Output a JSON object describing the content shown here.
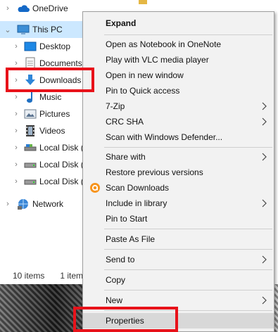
{
  "nav": {
    "items": [
      {
        "label": "OneDrive",
        "icon": "cloud-icon"
      },
      {
        "label": "This PC",
        "icon": "computer-icon"
      },
      {
        "label": "Desktop",
        "icon": "desktop-icon"
      },
      {
        "label": "Documents",
        "icon": "documents-icon"
      },
      {
        "label": "Downloads",
        "icon": "downloads-icon"
      },
      {
        "label": "Music",
        "icon": "music-icon"
      },
      {
        "label": "Pictures",
        "icon": "pictures-icon"
      },
      {
        "label": "Videos",
        "icon": "videos-icon"
      },
      {
        "label": "Local Disk (",
        "icon": "disk-icon"
      },
      {
        "label": "Local Disk (",
        "icon": "disk-icon"
      },
      {
        "label": "Local Disk (",
        "icon": "disk-icon"
      },
      {
        "label": "Network",
        "icon": "network-icon"
      }
    ]
  },
  "status": {
    "items_count": "10 items",
    "selected": "1 item"
  },
  "context_menu": {
    "items": [
      {
        "label": "Expand",
        "bold": true
      },
      {
        "label": "Open as Notebook in OneNote"
      },
      {
        "label": "Play with VLC media player"
      },
      {
        "label": "Open in new window"
      },
      {
        "label": "Pin to Quick access"
      },
      {
        "label": "7-Zip",
        "submenu": true
      },
      {
        "label": "CRC SHA",
        "submenu": true
      },
      {
        "label": "Scan with Windows Defender..."
      },
      {
        "label": "Share with",
        "submenu": true
      },
      {
        "label": "Restore previous versions"
      },
      {
        "label": "Scan Downloads",
        "icon": "avast-icon"
      },
      {
        "label": "Include in library",
        "submenu": true
      },
      {
        "label": "Pin to Start"
      },
      {
        "label": "Paste As File"
      },
      {
        "label": "Send to",
        "submenu": true
      },
      {
        "label": "Copy"
      },
      {
        "label": "New",
        "submenu": true
      },
      {
        "label": "Properties"
      }
    ]
  },
  "colors": {
    "annotation_red": "#e8121a",
    "selection_blue": "#cce8ff",
    "menu_bg": "#f2f2f2"
  }
}
